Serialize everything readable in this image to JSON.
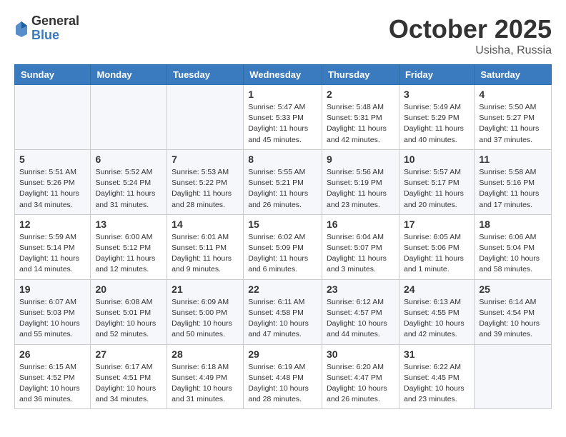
{
  "header": {
    "logo_general": "General",
    "logo_blue": "Blue",
    "month_title": "October 2025",
    "location": "Usisha, Russia"
  },
  "weekdays": [
    "Sunday",
    "Monday",
    "Tuesday",
    "Wednesday",
    "Thursday",
    "Friday",
    "Saturday"
  ],
  "weeks": [
    [
      {
        "day": "",
        "info": ""
      },
      {
        "day": "",
        "info": ""
      },
      {
        "day": "",
        "info": ""
      },
      {
        "day": "1",
        "info": "Sunrise: 5:47 AM\nSunset: 5:33 PM\nDaylight: 11 hours\nand 45 minutes."
      },
      {
        "day": "2",
        "info": "Sunrise: 5:48 AM\nSunset: 5:31 PM\nDaylight: 11 hours\nand 42 minutes."
      },
      {
        "day": "3",
        "info": "Sunrise: 5:49 AM\nSunset: 5:29 PM\nDaylight: 11 hours\nand 40 minutes."
      },
      {
        "day": "4",
        "info": "Sunrise: 5:50 AM\nSunset: 5:27 PM\nDaylight: 11 hours\nand 37 minutes."
      }
    ],
    [
      {
        "day": "5",
        "info": "Sunrise: 5:51 AM\nSunset: 5:26 PM\nDaylight: 11 hours\nand 34 minutes."
      },
      {
        "day": "6",
        "info": "Sunrise: 5:52 AM\nSunset: 5:24 PM\nDaylight: 11 hours\nand 31 minutes."
      },
      {
        "day": "7",
        "info": "Sunrise: 5:53 AM\nSunset: 5:22 PM\nDaylight: 11 hours\nand 28 minutes."
      },
      {
        "day": "8",
        "info": "Sunrise: 5:55 AM\nSunset: 5:21 PM\nDaylight: 11 hours\nand 26 minutes."
      },
      {
        "day": "9",
        "info": "Sunrise: 5:56 AM\nSunset: 5:19 PM\nDaylight: 11 hours\nand 23 minutes."
      },
      {
        "day": "10",
        "info": "Sunrise: 5:57 AM\nSunset: 5:17 PM\nDaylight: 11 hours\nand 20 minutes."
      },
      {
        "day": "11",
        "info": "Sunrise: 5:58 AM\nSunset: 5:16 PM\nDaylight: 11 hours\nand 17 minutes."
      }
    ],
    [
      {
        "day": "12",
        "info": "Sunrise: 5:59 AM\nSunset: 5:14 PM\nDaylight: 11 hours\nand 14 minutes."
      },
      {
        "day": "13",
        "info": "Sunrise: 6:00 AM\nSunset: 5:12 PM\nDaylight: 11 hours\nand 12 minutes."
      },
      {
        "day": "14",
        "info": "Sunrise: 6:01 AM\nSunset: 5:11 PM\nDaylight: 11 hours\nand 9 minutes."
      },
      {
        "day": "15",
        "info": "Sunrise: 6:02 AM\nSunset: 5:09 PM\nDaylight: 11 hours\nand 6 minutes."
      },
      {
        "day": "16",
        "info": "Sunrise: 6:04 AM\nSunset: 5:07 PM\nDaylight: 11 hours\nand 3 minutes."
      },
      {
        "day": "17",
        "info": "Sunrise: 6:05 AM\nSunset: 5:06 PM\nDaylight: 11 hours\nand 1 minute."
      },
      {
        "day": "18",
        "info": "Sunrise: 6:06 AM\nSunset: 5:04 PM\nDaylight: 10 hours\nand 58 minutes."
      }
    ],
    [
      {
        "day": "19",
        "info": "Sunrise: 6:07 AM\nSunset: 5:03 PM\nDaylight: 10 hours\nand 55 minutes."
      },
      {
        "day": "20",
        "info": "Sunrise: 6:08 AM\nSunset: 5:01 PM\nDaylight: 10 hours\nand 52 minutes."
      },
      {
        "day": "21",
        "info": "Sunrise: 6:09 AM\nSunset: 5:00 PM\nDaylight: 10 hours\nand 50 minutes."
      },
      {
        "day": "22",
        "info": "Sunrise: 6:11 AM\nSunset: 4:58 PM\nDaylight: 10 hours\nand 47 minutes."
      },
      {
        "day": "23",
        "info": "Sunrise: 6:12 AM\nSunset: 4:57 PM\nDaylight: 10 hours\nand 44 minutes."
      },
      {
        "day": "24",
        "info": "Sunrise: 6:13 AM\nSunset: 4:55 PM\nDaylight: 10 hours\nand 42 minutes."
      },
      {
        "day": "25",
        "info": "Sunrise: 6:14 AM\nSunset: 4:54 PM\nDaylight: 10 hours\nand 39 minutes."
      }
    ],
    [
      {
        "day": "26",
        "info": "Sunrise: 6:15 AM\nSunset: 4:52 PM\nDaylight: 10 hours\nand 36 minutes."
      },
      {
        "day": "27",
        "info": "Sunrise: 6:17 AM\nSunset: 4:51 PM\nDaylight: 10 hours\nand 34 minutes."
      },
      {
        "day": "28",
        "info": "Sunrise: 6:18 AM\nSunset: 4:49 PM\nDaylight: 10 hours\nand 31 minutes."
      },
      {
        "day": "29",
        "info": "Sunrise: 6:19 AM\nSunset: 4:48 PM\nDaylight: 10 hours\nand 28 minutes."
      },
      {
        "day": "30",
        "info": "Sunrise: 6:20 AM\nSunset: 4:47 PM\nDaylight: 10 hours\nand 26 minutes."
      },
      {
        "day": "31",
        "info": "Sunrise: 6:22 AM\nSunset: 4:45 PM\nDaylight: 10 hours\nand 23 minutes."
      },
      {
        "day": "",
        "info": ""
      }
    ]
  ]
}
